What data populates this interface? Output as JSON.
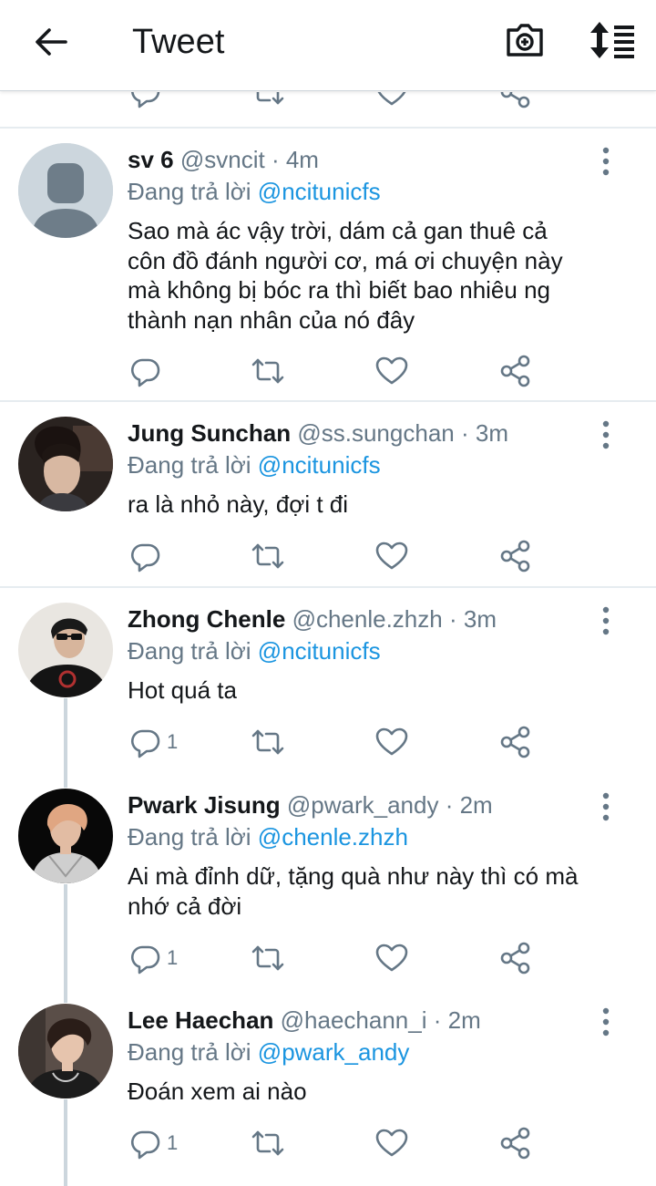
{
  "header": {
    "title": "Tweet",
    "back_icon": "arrow-left-icon",
    "camera_icon": "camera-icon",
    "sort_icon": "sort-icon"
  },
  "colors": {
    "link": "#1b95e0",
    "muted": "#657786",
    "text": "#14171a",
    "divider": "#e6ecf0",
    "thread_line": "#ccd6dd"
  },
  "tweets": [
    {
      "name": "sv 6",
      "handle": "@svncit",
      "dot": "·",
      "time": "4m",
      "reply_label": "Đang trả lời",
      "reply_to": "@ncitunicfs",
      "lines": [
        "Sao mà ác vậy trời, dám cả gan thuê cả",
        "côn đồ đánh người cơ, má ơi chuyện này",
        "mà không bị bóc ra thì biết bao nhiêu ng",
        "thành nạn nhân của nó đây"
      ],
      "reply_count": "",
      "avatar": "default"
    },
    {
      "name": "Jung Sunchan",
      "handle": "@ss.sungchan",
      "dot": "·",
      "time": "3m",
      "reply_label": "Đang trả lời",
      "reply_to": "@ncitunicfs",
      "lines": [
        "ra là nhỏ này, đợi t đi"
      ],
      "reply_count": "",
      "avatar": "photo"
    },
    {
      "name": "Zhong Chenle",
      "handle": "@chenle.zhzh",
      "dot": "·",
      "time": "3m",
      "reply_label": "Đang trả lời",
      "reply_to": "@ncitunicfs",
      "lines": [
        "Hot quá ta"
      ],
      "reply_count": "1",
      "avatar": "photo"
    },
    {
      "name": "Pwark Jisung",
      "handle": "@pwark_andy",
      "dot": "·",
      "time": "2m",
      "reply_label": "Đang trả lời",
      "reply_to": "@chenle.zhzh",
      "lines": [
        "Ai mà đỉnh dữ, tặng quà như này thì có mà",
        "nhớ cả đời"
      ],
      "reply_count": "1",
      "avatar": "photo"
    },
    {
      "name": "Lee Haechan",
      "handle": "@haechann_i",
      "dot": "·",
      "time": "2m",
      "reply_label": "Đang trả lời",
      "reply_to": "@pwark_andy",
      "lines": [
        "Đoán xem ai nào"
      ],
      "reply_count": "1",
      "avatar": "photo"
    }
  ]
}
